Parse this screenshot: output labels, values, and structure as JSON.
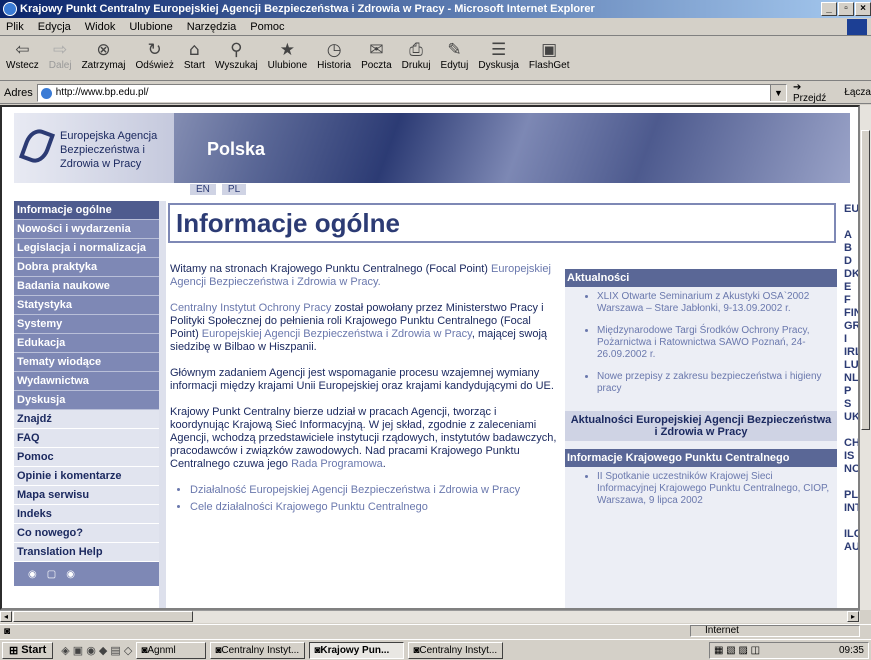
{
  "window": {
    "title": "Krajowy Punkt Centralny Europejskiej Agencji Bezpieczeństwa i Zdrowia w Pracy - Microsoft Internet Explorer"
  },
  "menu": [
    "Plik",
    "Edycja",
    "Widok",
    "Ulubione",
    "Narzędzia",
    "Pomoc"
  ],
  "toolbar": [
    {
      "label": "Wstecz",
      "icon": "back-icon",
      "glyph": "⇦"
    },
    {
      "label": "Dalej",
      "icon": "forward-icon",
      "glyph": "⇨",
      "disabled": true
    },
    {
      "label": "Zatrzymaj",
      "icon": "stop-icon",
      "glyph": "⊗"
    },
    {
      "label": "Odśwież",
      "icon": "refresh-icon",
      "glyph": "↻"
    },
    {
      "label": "Start",
      "icon": "home-icon",
      "glyph": "⌂"
    },
    {
      "label": "Wyszukaj",
      "icon": "search-icon",
      "glyph": "⚲"
    },
    {
      "label": "Ulubione",
      "icon": "favorites-icon",
      "glyph": "★"
    },
    {
      "label": "Historia",
      "icon": "history-icon",
      "glyph": "◷"
    },
    {
      "label": "Poczta",
      "icon": "mail-icon",
      "glyph": "✉"
    },
    {
      "label": "Drukuj",
      "icon": "print-icon",
      "glyph": "⎙"
    },
    {
      "label": "Edytuj",
      "icon": "edit-icon",
      "glyph": "✎"
    },
    {
      "label": "Dyskusja",
      "icon": "discuss-icon",
      "glyph": "☰"
    },
    {
      "label": "FlashGet",
      "icon": "flashget-icon",
      "glyph": "▣"
    }
  ],
  "address": {
    "label": "Adres",
    "url": "http://www.bp.edu.pl/",
    "go": "Przejdź",
    "links": "Łącza"
  },
  "banner": {
    "logo_lines": [
      "Europejska Agencja",
      "Bezpieczeństwa i",
      "Zdrowia w Pracy"
    ],
    "site_name": "Polska",
    "langs": [
      "EN",
      "PL"
    ]
  },
  "nav": [
    {
      "label": "Informacje ogólne",
      "style": "sel"
    },
    {
      "label": "Nowości i wydarzenia",
      "style": "dark"
    },
    {
      "label": "Legislacja i normalizacja",
      "style": "dark"
    },
    {
      "label": "Dobra praktyka",
      "style": "dark"
    },
    {
      "label": "Badania naukowe",
      "style": "dark"
    },
    {
      "label": "Statystyka",
      "style": "dark"
    },
    {
      "label": "Systemy",
      "style": "dark"
    },
    {
      "label": "Edukacja",
      "style": "dark"
    },
    {
      "label": "Tematy wiodące",
      "style": "dark"
    },
    {
      "label": "Wydawnictwa",
      "style": "dark"
    },
    {
      "label": "Dyskusja",
      "style": "dark"
    },
    {
      "label": "Znajdź",
      "style": "light"
    },
    {
      "label": "FAQ",
      "style": "light"
    },
    {
      "label": "Pomoc",
      "style": "light"
    },
    {
      "label": "Opinie i komentarze",
      "style": "light"
    },
    {
      "label": "Mapa serwisu",
      "style": "light"
    },
    {
      "label": "Indeks",
      "style": "light"
    },
    {
      "label": "Co nowego?",
      "style": "light"
    },
    {
      "label": "Translation Help",
      "style": "light"
    }
  ],
  "page": {
    "heading": "Informacje ogólne",
    "p1_a": "Witamy na stronach Krajowego Punktu Centralnego (Focal Point) ",
    "p1_link": "Europejskiej Agencji Bezpieczeństwa i Zdrowia w Pracy.",
    "p2_link1": "Centralny Instytut Ochrony Pracy",
    "p2_a": " został powołany przez Ministerstwo Pracy i Polityki Społecznej do pełnienia roli Krajowego Punktu Centralnego (Focal Point) ",
    "p2_link2": "Europejskiej Agencji Bezpieczeństwa i Zdrowia w Pracy",
    "p2_b": ", mającej swoją siedzibę w Bilbao w Hiszpanii.",
    "p3": "Głównym zadaniem Agencji jest wspomaganie procesu wzajemnej wymiany informacji między krajami Unii Europejskiej oraz krajami kandydującymi do UE.",
    "p4_a": "Krajowy Punkt Centralny bierze udział w pracach Agencji, tworząc i koordynując Krajową Sieć Informacyjną. W jej skład, zgodnie z zaleceniami Agencji, wchodzą przedstawiciele instytucji rządowych, instytutów badawczych, pracodawców i związków zawodowych. Nad pracami Krajowego Punktu Centralnego czuwa jego ",
    "p4_link": "Rada Programowa",
    "p4_b": ".",
    "list": [
      "Działalność Europejskiej Agencji Bezpieczeństwa i Zdrowia w Pracy",
      "Cele działalności Krajowego Punktu Centralnego"
    ]
  },
  "aside": {
    "news_head": "Aktualności",
    "news": [
      "XLIX Otwarte Seminarium z Akustyki OSA`2002 Warszawa – Stare Jabłonki, 9-13.09.2002 r.",
      "Międzynarodowe Targi Środków Ochrony Pracy, Pożarnictwa i Ratownictwa SAWO Poznań, 24-26.09.2002 r.",
      "Nowe przepisy z zakresu bezpieczeństwa i higieny pracy"
    ],
    "agency_head": "Aktualności Europejskiej Agencji Bezpieczeństwa i Zdrowia w Pracy",
    "kpc_head": "Informacje Krajowego Punktu Centralnego",
    "kpc": [
      "II Spotkanie uczestników Krajowej Sieci Informacyjnej Krajowego Punktu Centralnego, CIOP, Warszawa, 9 lipca 2002"
    ]
  },
  "countries": [
    "EU",
    "",
    "A",
    "B",
    "D",
    "DK",
    "E",
    "F",
    "FIN",
    "GR",
    "I",
    "IRL",
    "LUD",
    "NL",
    "P",
    "S",
    "UK",
    "",
    "CH",
    "IS",
    "NO",
    "",
    "PL",
    "INT",
    "",
    "ILO",
    "AU"
  ],
  "status": {
    "zone": "Internet"
  },
  "taskbar": {
    "start": "Start",
    "tasks": [
      {
        "label": "Agnml",
        "active": false
      },
      {
        "label": "Centralny Instyt...",
        "active": false
      },
      {
        "label": "Krajowy Pun...",
        "active": true
      },
      {
        "label": "Centralny Instyt...",
        "active": false
      }
    ],
    "clock": "09:35"
  }
}
